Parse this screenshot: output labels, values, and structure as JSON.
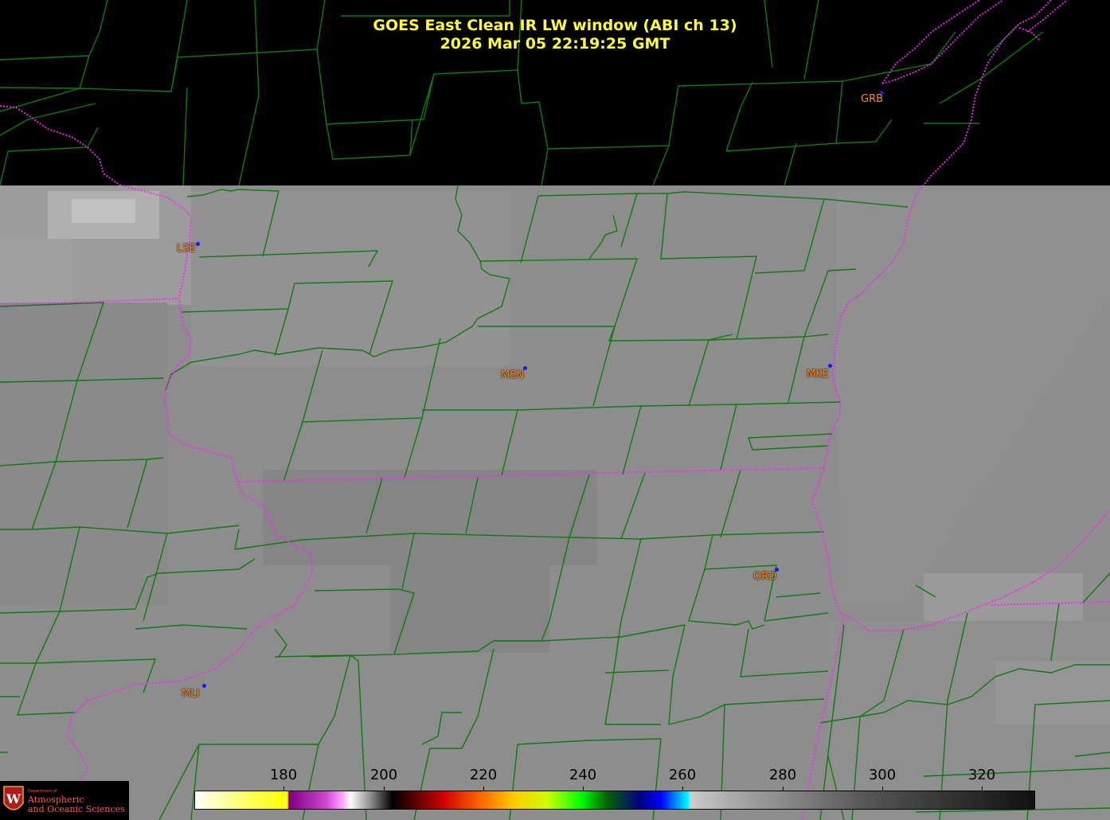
{
  "title": {
    "line1": "GOES East Clean IR LW window (ABI ch 13)",
    "line2": "2026 Mar 05  22:19:25 GMT"
  },
  "colors": {
    "county_lines": "#0b7d0b",
    "state_lines": "#ff22ff",
    "title_text": "#ffff33",
    "station_label": "#ff8c1a",
    "station_dot": "#1515ff",
    "cloud_gray": "#8a8a8a"
  },
  "stations": [
    {
      "id": "LSE",
      "label": "LSE"
    },
    {
      "id": "MSN",
      "label": "MSN"
    },
    {
      "id": "MKE",
      "label": "MKE"
    },
    {
      "id": "GRB",
      "label": "GRB"
    },
    {
      "id": "ORD",
      "label": "ORD"
    },
    {
      "id": "MLI",
      "label": "MLI"
    }
  ],
  "colorbar": {
    "unit_scale": "brightness temperature",
    "min": 163,
    "max": 330,
    "ticks": [
      "180",
      "200",
      "220",
      "240",
      "260",
      "280",
      "300",
      "320"
    ]
  },
  "logo": {
    "line_small": "Department of",
    "line1": "Atmospheric",
    "line2": "and Oceanic Sciences",
    "seal_letter": "W"
  }
}
